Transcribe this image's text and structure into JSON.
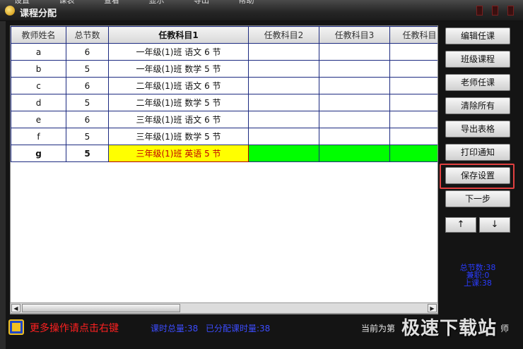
{
  "window": {
    "title": "课程分配",
    "menu": [
      "设置",
      "课表",
      "查看",
      "显示",
      "导出",
      "帮助"
    ]
  },
  "grid": {
    "headers": [
      "教师姓名",
      "总节数",
      "任教科目1",
      "任教科目2",
      "任教科目3",
      "任教科目"
    ],
    "rows": [
      {
        "name": "a",
        "hours": "6",
        "subject1": "一年级(1)班 语文 6 节"
      },
      {
        "name": "b",
        "hours": "5",
        "subject1": "一年级(1)班 数学 5 节"
      },
      {
        "name": "c",
        "hours": "6",
        "subject1": "二年级(1)班 语文 6 节"
      },
      {
        "name": "d",
        "hours": "5",
        "subject1": "二年级(1)班 数学 5 节"
      },
      {
        "name": "e",
        "hours": "6",
        "subject1": "三年级(1)班 语文 6 节"
      },
      {
        "name": "f",
        "hours": "5",
        "subject1": "三年级(1)班 数学 5 节"
      },
      {
        "name": "g",
        "hours": "5",
        "subject1": "三年级(1)班 英语 5 节",
        "selected": true
      }
    ]
  },
  "sidebar": {
    "buttons": [
      "编辑任课",
      "班级课程",
      "老师任课",
      "清除所有",
      "导出表格",
      "打印通知",
      "保存设置",
      "下一步"
    ],
    "up": "↑",
    "down": "↓",
    "stats": {
      "total": "总节数:38",
      "parttime": "兼职:0",
      "classes": "上课:38"
    }
  },
  "footer": {
    "hint": "更多操作请点击右键",
    "total_hours": "课时总量:38",
    "assigned_hours": "已分配课时量:38",
    "current": "当前为第",
    "current_tail": "师"
  },
  "watermark": "极速下载站",
  "colors": {
    "selected_cell": "#ffff00",
    "assigned_cell": "#00ff00",
    "hint": "#ff2020",
    "info": "#3c4cff"
  }
}
